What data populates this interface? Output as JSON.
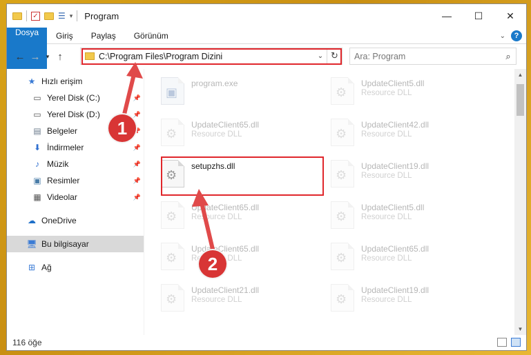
{
  "window": {
    "title": "Program"
  },
  "ribbon": {
    "tabs": [
      "Dosya",
      "Giriş",
      "Paylaş",
      "Görünüm"
    ]
  },
  "address": {
    "path": "C:\\Program Files\\Program Dizini"
  },
  "search": {
    "placeholder": "Ara: Program"
  },
  "sidebar": {
    "items": [
      {
        "label": "Hızlı erişim",
        "icon": "star-icon"
      },
      {
        "label": "Yerel Disk (C:)",
        "icon": "drive-icon"
      },
      {
        "label": "Yerel Disk (D:)",
        "icon": "drive-icon"
      },
      {
        "label": "Belgeler",
        "icon": "document-icon"
      },
      {
        "label": "İndirmeler",
        "icon": "download-icon"
      },
      {
        "label": "Müzik",
        "icon": "music-icon"
      },
      {
        "label": "Resimler",
        "icon": "pictures-icon"
      },
      {
        "label": "Videolar",
        "icon": "video-icon"
      },
      {
        "label": "OneDrive",
        "icon": "cloud-icon"
      },
      {
        "label": "Bu bilgisayar",
        "icon": "computer-icon"
      },
      {
        "label": "Ağ",
        "icon": "network-icon"
      }
    ]
  },
  "files": [
    {
      "name": "program.exe",
      "type": ""
    },
    {
      "name": "UpdateClient5.dll",
      "type": "Resource DLL"
    },
    {
      "name": "UpdateClient65.dll",
      "type": "Resource DLL"
    },
    {
      "name": "UpdateClient42.dll",
      "type": "Resource DLL"
    },
    {
      "name": "setupzhs.dll",
      "type": ""
    },
    {
      "name": "UpdateClient19.dll",
      "type": "Resource DLL"
    },
    {
      "name": "UpdateClient65.dll",
      "type": "Resource DLL"
    },
    {
      "name": "UpdateClient5.dll",
      "type": "Resource DLL"
    },
    {
      "name": "UpdateClient65.dll",
      "type": "Resource DLL"
    },
    {
      "name": "UpdateClient65.dll",
      "type": "Resource DLL"
    },
    {
      "name": "UpdateClient21.dll",
      "type": "Resource DLL"
    },
    {
      "name": "UpdateClient19.dll",
      "type": "Resource DLL"
    }
  ],
  "status": {
    "count": "116 öğe"
  },
  "annotations": {
    "badge1": "1",
    "badge2": "2",
    "color": "#d83535"
  }
}
